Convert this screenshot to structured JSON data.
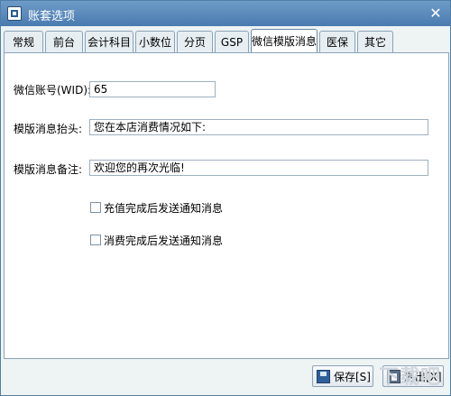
{
  "window": {
    "title": "账套选项",
    "close_glyph": "✕"
  },
  "tabs": [
    {
      "label": "常规"
    },
    {
      "label": "前台"
    },
    {
      "label": "会计科目"
    },
    {
      "label": "小数位"
    },
    {
      "label": "分页"
    },
    {
      "label": "GSP"
    },
    {
      "label": "微信模版消息",
      "active": true
    },
    {
      "label": "医保"
    },
    {
      "label": "其它"
    }
  ],
  "form": {
    "wid_label": "微信账号(WID):",
    "wid_value": "65",
    "header_label": "模版消息抬头:",
    "header_value": "您在本店消费情况如下:",
    "note_label": "模版消息备注:",
    "note_value": "欢迎您的再次光临!",
    "check1_label": "充值完成后发送通知消息",
    "check2_label": "消费完成后发送通知消息"
  },
  "footer": {
    "save_label": "保存[S]",
    "exit_label": "退出[X]"
  },
  "watermark": "下载吧"
}
